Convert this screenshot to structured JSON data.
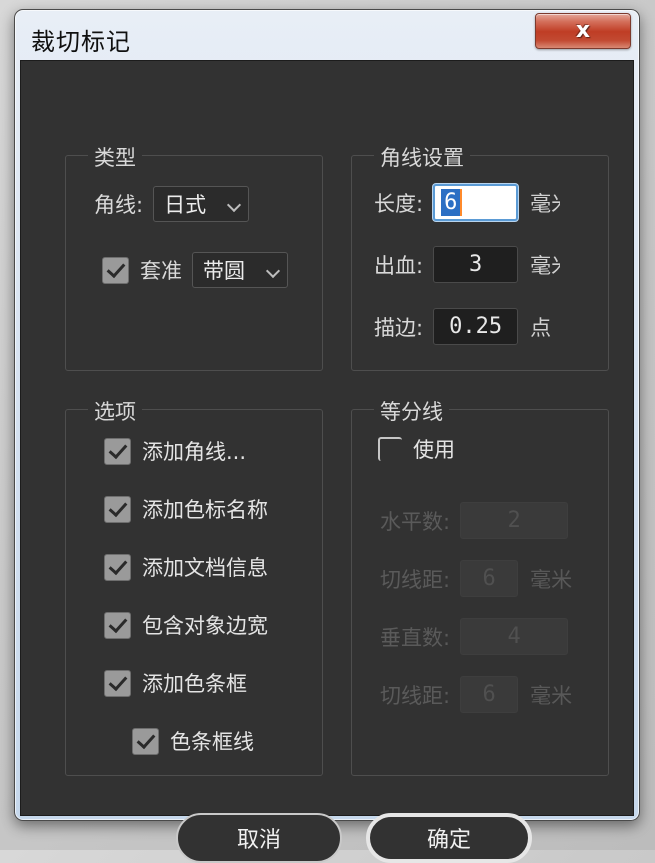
{
  "window": {
    "title": "裁切标记",
    "close_label": "x",
    "accent_red": "#bf3d25",
    "titlebar_color": "#d3e0f0",
    "body_color": "#323232"
  },
  "type_group": {
    "legend": "类型",
    "corner_label": "角线:",
    "corner_value": "日式",
    "registration_label": "套准",
    "registration_checked": true,
    "registration_value": "带圆"
  },
  "corner_group": {
    "legend": "角线设置",
    "rows": [
      {
        "label": "长度:",
        "value": "6",
        "unit": "毫米",
        "focused": true
      },
      {
        "label": "出血:",
        "value": "3",
        "unit": "毫米",
        "focused": false
      },
      {
        "label": "描边:",
        "value": "0.25",
        "unit": "点",
        "focused": false
      }
    ]
  },
  "options_group": {
    "legend": "选项",
    "items": [
      {
        "label": "添加角线...",
        "checked": true,
        "indent": false
      },
      {
        "label": "添加色标名称",
        "checked": true,
        "indent": false
      },
      {
        "label": "添加文档信息",
        "checked": true,
        "indent": false
      },
      {
        "label": "包含对象边宽",
        "checked": true,
        "indent": false
      },
      {
        "label": "添加色条框",
        "checked": true,
        "indent": false
      },
      {
        "label": "色条框线",
        "checked": true,
        "indent": true
      }
    ]
  },
  "divider_group": {
    "legend": "等分线",
    "use_label": "使用",
    "use_checked": false,
    "rows": [
      {
        "label": "水平数:",
        "value": "2",
        "unit": ""
      },
      {
        "label": "切线距:",
        "value": "6",
        "unit": "毫米"
      },
      {
        "label": "垂直数:",
        "value": "4",
        "unit": ""
      },
      {
        "label": "切线距:",
        "value": "6",
        "unit": "毫米"
      }
    ]
  },
  "footer": {
    "cancel_label": "取消",
    "ok_label": "确定"
  }
}
